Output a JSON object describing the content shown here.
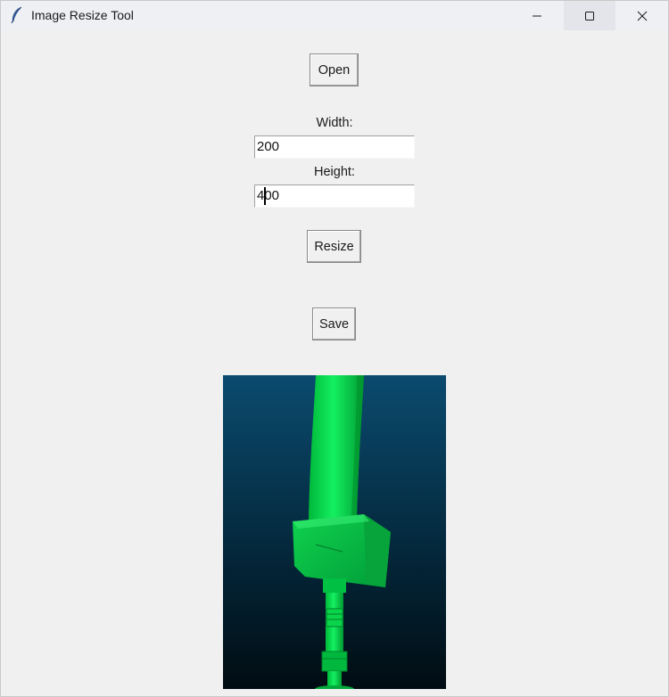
{
  "window": {
    "title": "Image Resize Tool",
    "controls": {
      "minimize": "minimize",
      "maximize": "maximize",
      "close": "close"
    }
  },
  "form": {
    "open_label": "Open",
    "width_label": "Width:",
    "width_value": "200",
    "height_label": "Height:",
    "height_value": "400",
    "resize_label": "Resize",
    "save_label": "Save"
  },
  "preview": {
    "icon": "feather-icon",
    "background_top": "#0a4a6e",
    "background_bottom": "#021016",
    "object_color": "#00e04a"
  }
}
